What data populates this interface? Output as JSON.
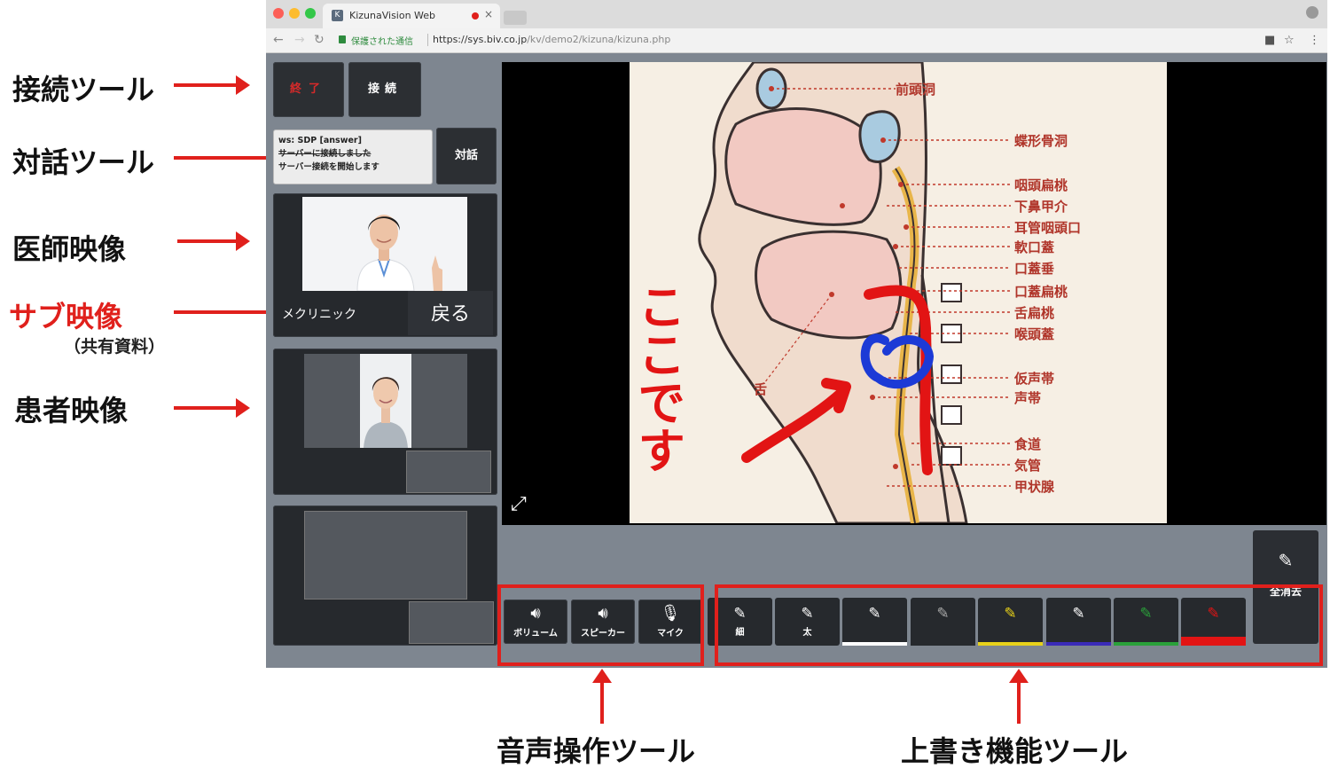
{
  "annotations": {
    "connect_tool": "接続ツール",
    "dialog_tool": "対話ツール",
    "doctor_video": "医師映像",
    "sub_video": "サブ映像",
    "sub_video_note": "（共有資料）",
    "patient_video": "患者映像",
    "audio_tool": "音声操作ツール",
    "overwrite_tool": "上書き機能ツール"
  },
  "browser": {
    "tab_title": "KizunaVision Web",
    "tab_favicon": "K",
    "secure_label": "保護された通信",
    "url_host": "https://sys.biv.co.jp",
    "url_path": "/kv/demo2/kizuna/kizuna.php"
  },
  "session": {
    "end_label": "終了",
    "connect_label": "接続",
    "dialog_label": "対話",
    "log_lines": [
      "ws: SDP [answer]",
      "サーバーに接続しました",
      "サーバー接続を開始します"
    ],
    "doctor_name_label": "メクリニック",
    "back_label": "戻る"
  },
  "audio": {
    "volume_label": "ボリューム",
    "speaker_label": "スピーカー",
    "mic_label": "マイク"
  },
  "pens": {
    "thin_label": "細",
    "thick_label": "太",
    "colors": [
      "#ffffff",
      "#26292d",
      "#e8d21a",
      "#3a2bb8",
      "#2aa13a",
      "#e21414"
    ],
    "clear_all_label": "全消去"
  },
  "slide": {
    "labels": [
      "前頭洞",
      "蝶形骨洞",
      "咽頭扁桃",
      "下鼻甲介",
      "耳管咽頭口",
      "軟口蓋",
      "口蓋垂",
      "口蓋扁桃",
      "舌扁桃",
      "喉頭蓋",
      "仮声帯",
      "声帯",
      "食道",
      "気管",
      "甲状腺"
    ],
    "tongue_label": "舌",
    "handwriting": "ここです"
  },
  "icons": {
    "volume": "speaker-icon",
    "mic": "microphone-icon",
    "pen": "pencil-icon",
    "expand": "expand-icon"
  }
}
